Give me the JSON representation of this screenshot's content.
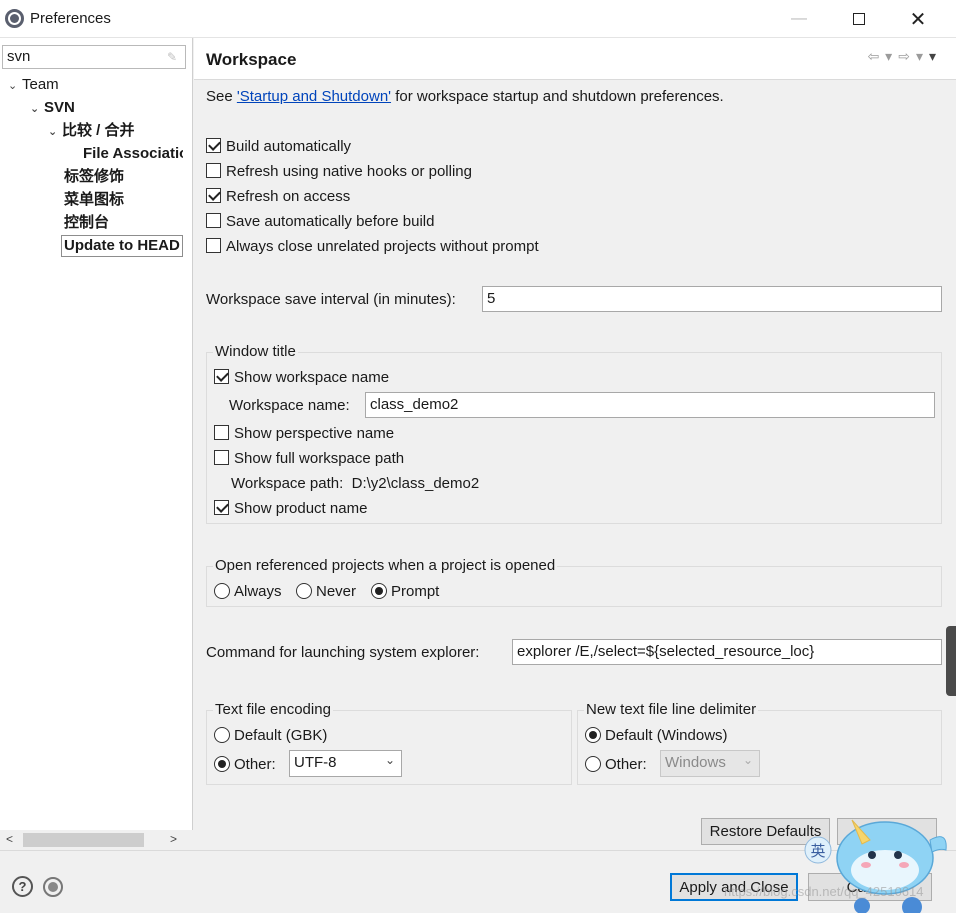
{
  "window": {
    "title": "Preferences",
    "minimize_glyph": "—",
    "close_glyph": "✕"
  },
  "filter": {
    "value": "svn"
  },
  "tree": {
    "items": [
      {
        "label": "Team"
      },
      {
        "label": "SVN"
      },
      {
        "label": "比较 / 合并"
      },
      {
        "label": "File Associatio"
      },
      {
        "label": "标签修饰"
      },
      {
        "label": "菜单图标"
      },
      {
        "label": "控制台"
      },
      {
        "label": "Update to HEAD"
      }
    ]
  },
  "page": {
    "title": "Workspace",
    "intro_prefix": "See ",
    "intro_link": "'Startup and Shutdown'",
    "intro_suffix": " for workspace startup and shutdown preferences.",
    "checkboxes": [
      {
        "label": "Build automatically",
        "checked": true
      },
      {
        "label": "Refresh using native hooks or polling",
        "checked": false
      },
      {
        "label": "Refresh on access",
        "checked": true
      },
      {
        "label": "Save automatically before build",
        "checked": false
      },
      {
        "label": "Always close unrelated projects without prompt",
        "checked": false
      }
    ],
    "save_interval": {
      "label": "Workspace save interval (in minutes):",
      "value": "5"
    },
    "window_title": {
      "legend": "Window title",
      "show_workspace_name": "Show workspace name",
      "workspace_name_label": "Workspace name:",
      "workspace_name_value": "class_demo2",
      "show_perspective_name": "Show perspective name",
      "show_full_path": "Show full workspace path",
      "workspace_path_label": "Workspace path:",
      "workspace_path_value": "D:\\y2\\class_demo2",
      "show_product_name": "Show product name"
    },
    "open_referenced": {
      "legend": "Open referenced projects when a project is opened",
      "options": [
        "Always",
        "Never",
        "Prompt"
      ],
      "selected": "Prompt"
    },
    "explorer": {
      "label": "Command for launching system explorer:",
      "value": "explorer /E,/select=${selected_resource_loc}"
    },
    "encoding": {
      "legend": "Text file encoding",
      "default_label": "Default (GBK)",
      "other_label": "Other:",
      "other_value": "UTF-8",
      "selected": "Other"
    },
    "line_delimiter": {
      "legend": "New text file line delimiter",
      "default_label": "Default (Windows)",
      "other_label": "Other:",
      "other_value": "Windows",
      "selected": "Default"
    },
    "restore_defaults": "Restore Defaults",
    "apply": "Apply"
  },
  "footer": {
    "apply_close": "Apply and Close",
    "cancel": "Cancel"
  },
  "overlay": {
    "ime_label": "英",
    "watermark": "https://blog.csdn.net/qq_42510614"
  }
}
